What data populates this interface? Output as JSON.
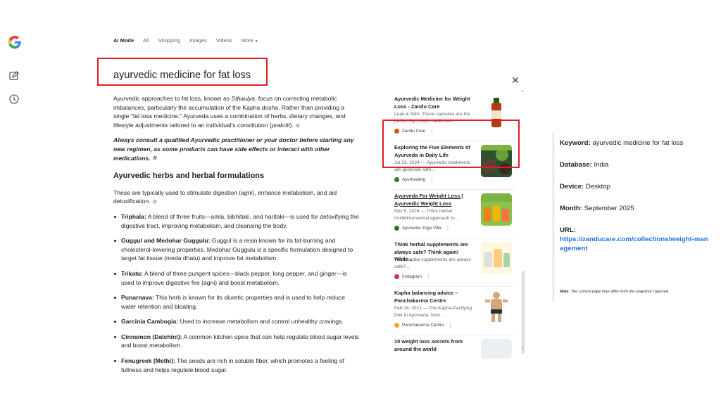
{
  "tabs": [
    {
      "label": "AI Mode",
      "active": true
    },
    {
      "label": "All"
    },
    {
      "label": "Shopping"
    },
    {
      "label": "Images"
    },
    {
      "label": "Videos"
    },
    {
      "label": "More"
    }
  ],
  "query": "ayurvedic medicine for fat loss",
  "answer": {
    "intro_1": "Ayurvedic approaches to fat loss, known as ",
    "intro_term": "Sthaulya",
    "intro_2": ", focus on correcting metabolic imbalances, particularly the accumulation of the Kapha dosha. Rather than providing a single \"fat loss medicine,\" Ayurveda uses a combination of herbs, dietary changes, and lifestyle adjustments tailored to an individual's constitution (",
    "intro_term2": "prakriti",
    "intro_3": ").",
    "warning": "Always consult a qualified Ayurvedic practitioner or your doctor before starting any new regimen, as some products can have side effects or interact with other medications.",
    "section_heading": "Ayurvedic herbs and herbal formulations",
    "section_intro_1": "These are typically used to stimulate digestion (",
    "section_intro_term": "agni",
    "section_intro_2": "), enhance metabolism, and aid detoxification.",
    "items": [
      {
        "name": "Triphala:",
        "text": " A blend of three fruits—amla, bibhitaki, and haritaki—is used for detoxifying the digestive tract, improving metabolism, and cleansing the body."
      },
      {
        "name": "Guggul and Medohar Guggulu:",
        "text": " Guggul is a resin known for its fat-burning and cholesterol-lowering properties. Medohar Guggulu is a specific formulation designed to target fat tissue (meda dhatu) and improve fat metabolism."
      },
      {
        "name": "Trikatu:",
        "text": " A blend of three pungent spices—black pepper, long pepper, and ginger—is used to improve digestive fire (agni) and boost metabolism."
      },
      {
        "name": "Punarnava:",
        "text": " This herb is known for its diuretic properties and is used to help reduce water retention and bloating."
      },
      {
        "name": "Garcinia Cambogia:",
        "text": " Used to increase metabolism and control unhealthy cravings."
      },
      {
        "name": "Cinnamon (Dalchini):",
        "text": " A common kitchen spice that can help regulate blood sugar levels and boost metabolism."
      },
      {
        "name": "Fenugreek (Methi):",
        "text": " The seeds are rich in soluble fiber, which promotes a feeling of fullness and helps regulate blood sugar."
      }
    ]
  },
  "sources": [
    {
      "title": "Ayurvedic Medicine for Weight Loss - Zandu Care",
      "meta": "Lean & Slim: These capsules are the perfect Ayurvedic medicines...",
      "site": "Zandu Care",
      "site_color": "#e65100",
      "thumb": "bottle",
      "underline": false
    },
    {
      "title": "Exploring the Five Elements of Ayurveda in Daily Life",
      "meta": "Jul 23, 2024 — Ayurvedic treatments are generally safe...",
      "site": "Ayurhealing",
      "site_color": "#2e7d32",
      "thumb": "herbs",
      "underline": false
    },
    {
      "title": "Ayurveda For Weight Loss | Ayurvedic Weight Loss",
      "meta": "Nov 5, 2024 — Think herbal multidimensional approach to...",
      "site": "Ayurveda Yoga Villa",
      "site_color": "#33691e",
      "thumb": "products",
      "underline": true
    },
    {
      "title": "Think herbal supplements are always safe? Think again! While...",
      "meta": "Think herbal supplements are always safe?...",
      "site": "Instagram",
      "site_color": "#d62976",
      "thumb": "jars",
      "underline": false
    },
    {
      "title": "Kapha balancing advice – Panchakarma Centre",
      "meta": "Feb 28, 2021 — The Kapha-Pacifying Diet In Ayurveda, food ...",
      "site": "Panchakarma Centre",
      "site_color": "#f9a825",
      "thumb": "person",
      "underline": false
    },
    {
      "title": "10 weight loss secrets from around the world",
      "meta": "",
      "site": "",
      "site_color": "#9e9e9e",
      "thumb": "blank",
      "underline": false
    }
  ],
  "info": {
    "keyword_label": "Keyword:",
    "keyword_value": " ayurvedic medicine for fat loss",
    "database_label": "Database:",
    "database_value": " India",
    "device_label": "Device:",
    "device_value": " Desktop",
    "month_label": "Month:",
    "month_value": " September 2025",
    "url_label": "URL:",
    "url_value": "https://zanducare.com/collections/weight-management"
  },
  "note": {
    "label": "Note",
    "text": ": The current page may differ from the snapshot captured."
  }
}
